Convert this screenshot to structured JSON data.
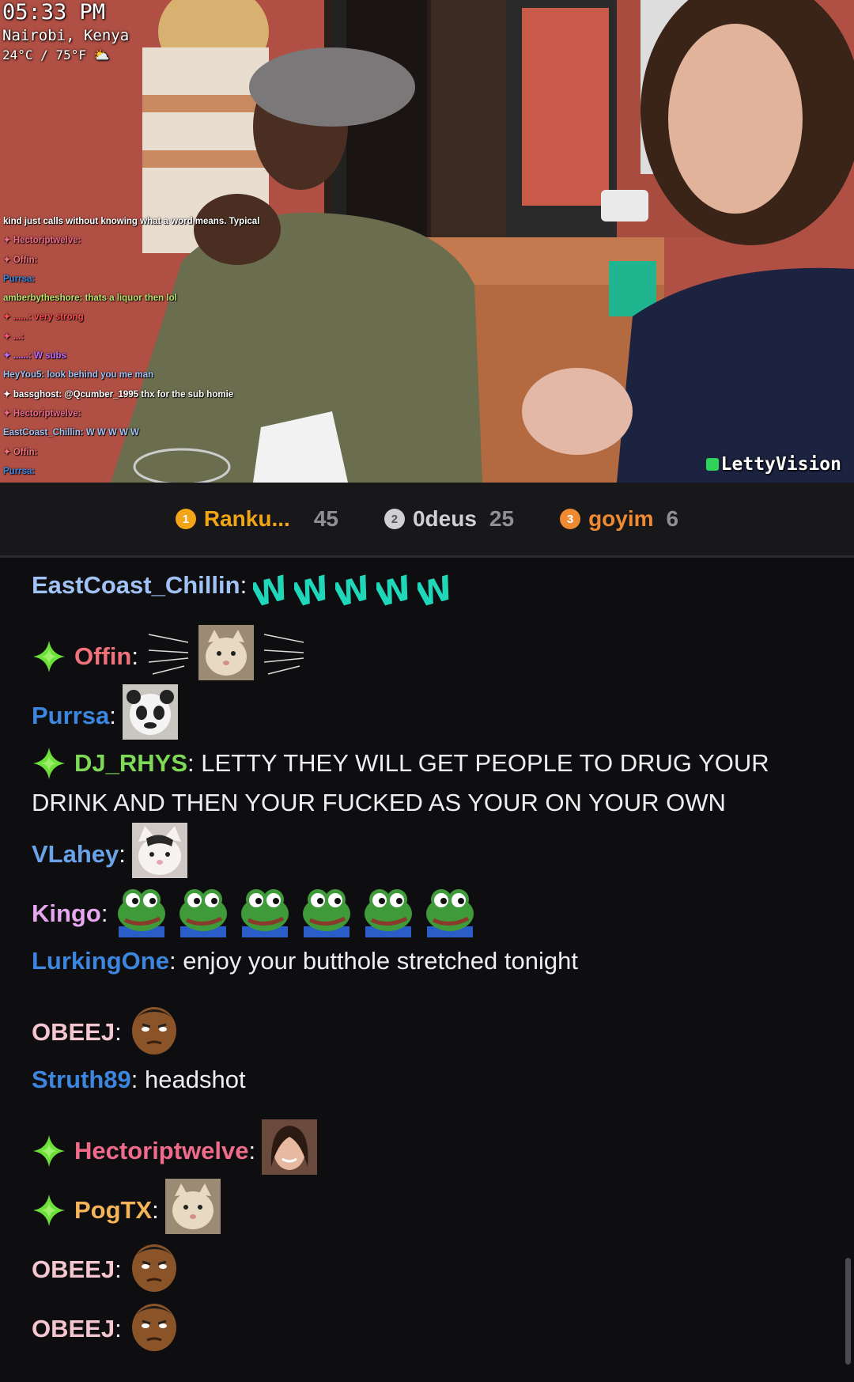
{
  "stream_overlay": {
    "time": "05:33 PM",
    "location": "Nairobi, Kenya",
    "weather": "24°C / 75°F ⛅",
    "watermark": "LettyVision",
    "overlay_chat": [
      "kind just calls without knowing what a word means. Typical",
      "✦ Hectoriptwelve:",
      "✦ Offin:",
      "Purrsa:",
      "amberbytheshore: thats a liquor then lol",
      "✦ ......: very strong",
      "✦ ...:",
      "✦ ......: W subs",
      "HeyYou5: look behind you me man",
      "✦ bassghost: @Qcumber_1995 thx for the sub homie",
      "✦ Hectoriptwelve:",
      "EastCoast_Chillin: W W W W W",
      "✦ Offin:",
      "Purrsa:"
    ]
  },
  "leaderboard": [
    {
      "rank": "1",
      "name": "Ranku...",
      "score": "45"
    },
    {
      "rank": "2",
      "name": "0deus",
      "score": "25"
    },
    {
      "rank": "3",
      "name": "goyim",
      "score": "6"
    }
  ],
  "colors": {
    "background": "#0e0e10",
    "leaderboard_bg": "#18181b",
    "gold": "#f2a516",
    "silver": "#cfcfd4",
    "bronze": "#f08a32"
  },
  "chat": [
    {
      "user": "EastCoast_Chillin",
      "sep": ":",
      "text": "",
      "emotes": [
        "W-emote",
        "W-emote",
        "W-emote",
        "W-emote",
        "W-emote"
      ],
      "color": "#a0c2f5"
    },
    {
      "user": "Offin",
      "sep": ":",
      "text": "",
      "badge": "sub-badge-icon",
      "emotes": [
        "speed-lines-emote",
        "cat-emote",
        "speed-lines-emote"
      ],
      "color": "#f2727c"
    },
    {
      "user": "Purrsa",
      "sep": ":",
      "text": "",
      "emotes": [
        "panda-emote"
      ],
      "color": "#3c86e0"
    },
    {
      "user": "DJ_RHYS",
      "sep": ":",
      "text": "LETTY THEY WILL GET PEOPLE TO DRUG YOUR DRINK AND THEN YOUR FUCKED AS YOUR ON YOUR OWN",
      "badge": "sub-badge-icon",
      "color": "#7ed957"
    },
    {
      "user": "VLahey",
      "sep": ":",
      "text": "",
      "emotes": [
        "beluga-cat-emote"
      ],
      "color": "#6aa3e8"
    },
    {
      "user": "Kingo",
      "sep": ":",
      "text": "",
      "emotes": [
        "pepe-emote",
        "pepe-emote",
        "pepe-emote",
        "pepe-emote",
        "pepe-emote",
        "pepe-emote"
      ],
      "color": "#e6a6f0"
    },
    {
      "user": "LurkingOne",
      "sep": ":",
      "text": "enjoy your butthole stretched tonight",
      "color": "#3c86e0"
    },
    {
      "user": "OBEEJ",
      "sep": ":",
      "text": "",
      "emotes": [
        "face-emote"
      ],
      "color": "#f4c6cf"
    },
    {
      "user": "Struth89",
      "sep": ":",
      "text": "headshot",
      "color": "#3c86e0"
    },
    {
      "user": "Hectoriptwelve",
      "sep": ":",
      "text": "",
      "badge": "sub-badge-icon",
      "emotes": [
        "letty-emote"
      ],
      "color": "#f06a8a"
    },
    {
      "user": "PogTX",
      "sep": ":",
      "text": "",
      "badge": "sub-badge-icon",
      "emotes": [
        "cat-emote"
      ],
      "color": "#f5b35a"
    },
    {
      "user": "OBEEJ",
      "sep": ":",
      "text": "",
      "emotes": [
        "face-emote"
      ],
      "color": "#f4c6cf"
    },
    {
      "user": "OBEEJ",
      "sep": ":",
      "text": "",
      "emotes": [
        "face-emote"
      ],
      "color": "#f4c6cf"
    }
  ]
}
